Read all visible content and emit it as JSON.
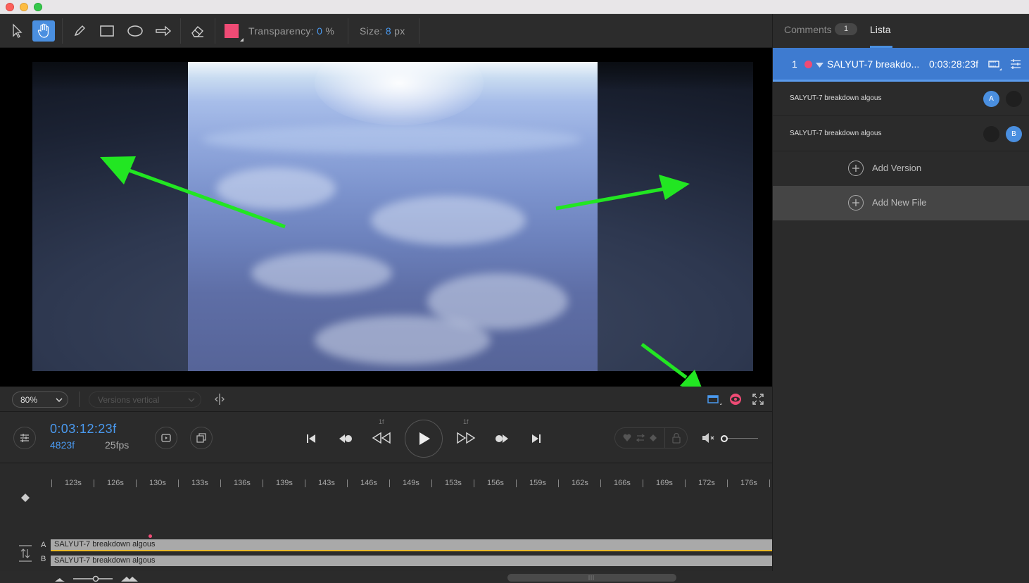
{
  "window": {
    "buttons": [
      "close",
      "minimize",
      "maximize"
    ]
  },
  "toolbar": {
    "tools": [
      "arrow-select-icon",
      "hand-pan-icon",
      "pen-icon",
      "rectangle-icon",
      "ellipse-icon",
      "arrow-draw-icon",
      "eraser-icon"
    ],
    "active_tool": "hand-pan-icon",
    "color": "#ef4b75",
    "transparency_label": "Transparency:",
    "transparency_value": "0",
    "transparency_unit": "%",
    "size_label": "Size:",
    "size_value": "8",
    "size_unit": "px"
  },
  "viewbar": {
    "zoom": "80%",
    "layout_select": "Versions vertical"
  },
  "transport": {
    "timecode": "0:03:12:23f",
    "frames": "4823f",
    "fps": "25fps",
    "step_back_label": "1f",
    "step_fwd_label": "1f"
  },
  "timeline": {
    "ruler": [
      "123s",
      "126s",
      "130s",
      "133s",
      "136s",
      "139s",
      "143s",
      "146s",
      "149s",
      "153s",
      "156s",
      "159s",
      "162s",
      "166s",
      "169s",
      "172s",
      "176s"
    ],
    "tracks": [
      {
        "letter": "A",
        "name": "SALYUT-7 breakdown algous"
      },
      {
        "letter": "B",
        "name": "SALYUT-7 breakdown algous"
      }
    ]
  },
  "panel": {
    "tabs": {
      "comments": "Comments",
      "comments_count": "1",
      "list": "Lista"
    },
    "file": {
      "number": "1",
      "name": "SALYUT-7 breakdo...",
      "timecode": "0:03:28:23f"
    },
    "versions": [
      {
        "name": "SALYUT-7 breakdown algous",
        "a": "A",
        "b": ""
      },
      {
        "name": "SALYUT-7 breakdown algous",
        "a": "",
        "b": "B"
      }
    ],
    "add_version": "Add Version",
    "add_new_file": "Add New File"
  },
  "colors": {
    "accent": "#4a8fe0",
    "marker": "#ef4b75",
    "track_highlight": "#e8b82a",
    "annotation_arrow": "#22e622"
  }
}
